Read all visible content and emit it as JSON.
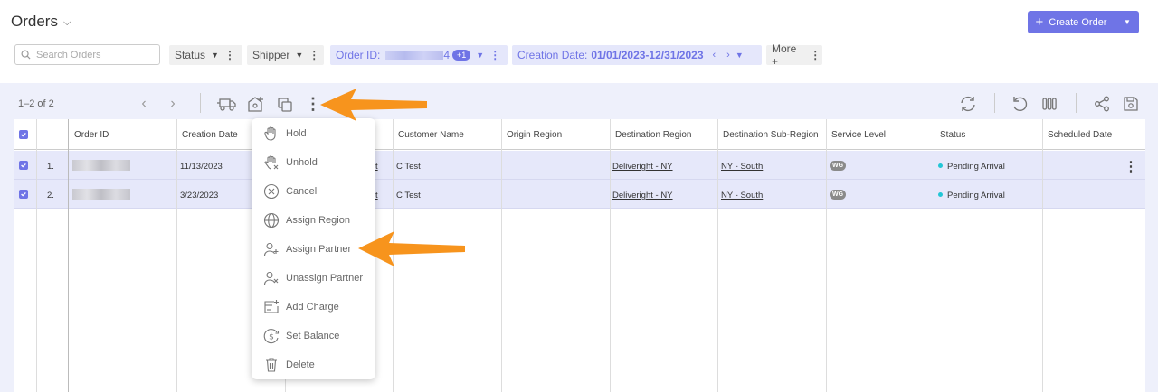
{
  "header": {
    "title": "Orders",
    "create_label": "Create Order"
  },
  "filters": {
    "search_placeholder": "Search Orders",
    "status": "Status",
    "shipper": "Shipper",
    "order_id_label": "Order ID:",
    "order_id_suffix": "4",
    "order_id_badge": "+1",
    "creation_date_label": "Creation Date:",
    "creation_date_value": "01/01/2023-12/31/2023",
    "more": "More +"
  },
  "pagination": {
    "count": "1–2 of 2"
  },
  "table": {
    "columns": [
      "Order ID",
      "Creation Date",
      "Customer Name",
      "Origin Region",
      "Destination Region",
      "Destination Sub-Region",
      "Service Level",
      "Status",
      "Scheduled Date"
    ],
    "rows": [
      {
        "num": "1.",
        "creation_date": "11/13/2023",
        "partial": "t",
        "customer": "C Test",
        "destination_region": "Deliveright - NY",
        "sub_region": "NY - South",
        "service": "WG",
        "status": "Pending Arrival"
      },
      {
        "num": "2.",
        "creation_date": "3/23/2023",
        "partial": "t",
        "customer": "C Test",
        "destination_region": "Deliveright - NY",
        "sub_region": "NY - South",
        "service": "WG",
        "status": "Pending Arrival"
      }
    ]
  },
  "menu": {
    "items": [
      "Hold",
      "Unhold",
      "Cancel",
      "Assign Region",
      "Assign Partner",
      "Unassign Partner",
      "Add Charge",
      "Set Balance",
      "Delete"
    ]
  },
  "colors": {
    "accent": "#6f74e6",
    "arrow": "#f7941d",
    "status_dot": "#22c6d6"
  }
}
